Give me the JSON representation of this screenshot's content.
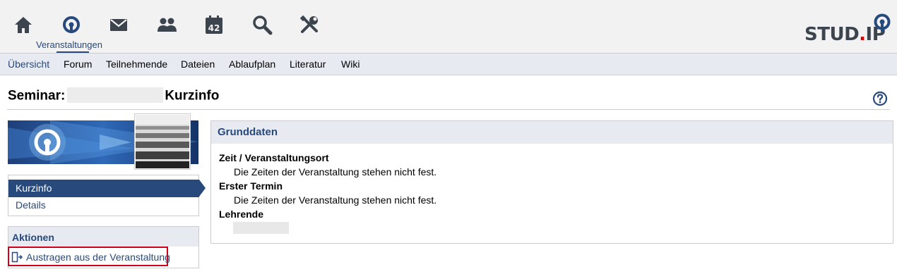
{
  "topnav": {
    "items": [
      {
        "name": "home-icon"
      },
      {
        "name": "courses-icon"
      },
      {
        "name": "messages-icon"
      },
      {
        "name": "community-icon"
      },
      {
        "name": "calendar-icon",
        "badge": "42"
      },
      {
        "name": "search-icon"
      },
      {
        "name": "tools-icon"
      }
    ],
    "active_label": "Veranstaltungen"
  },
  "logo": {
    "text_before": "STUD",
    "dot": ".",
    "text_after": "IP"
  },
  "tabs": [
    {
      "label": "Übersicht",
      "active": true
    },
    {
      "label": "Forum"
    },
    {
      "label": "Teilnehmende"
    },
    {
      "label": "Dateien"
    },
    {
      "label": "Ablaufplan"
    },
    {
      "label": "Literatur"
    },
    {
      "label": "Wiki"
    }
  ],
  "page": {
    "title_prefix": "Seminar:",
    "title_suffix": "Kurzinfo"
  },
  "sidebar": {
    "nav": [
      {
        "label": "Kurzinfo",
        "active": true
      },
      {
        "label": "Details"
      }
    ],
    "actions": {
      "title": "Aktionen",
      "leave_label": "Austragen aus der Veranstaltung"
    }
  },
  "main": {
    "title": "Grunddaten",
    "fields": {
      "time_label": "Zeit / Veranstaltungsort",
      "time_value": "Die Zeiten der Veranstaltung stehen nicht fest.",
      "first_label": "Erster Termin",
      "first_value": "Die Zeiten der Veranstaltung stehen nicht fest.",
      "teachers_label": "Lehrende"
    }
  },
  "colors": {
    "accent": "#28497c",
    "highlight": "#d0021b",
    "icon": "#3c454e"
  }
}
